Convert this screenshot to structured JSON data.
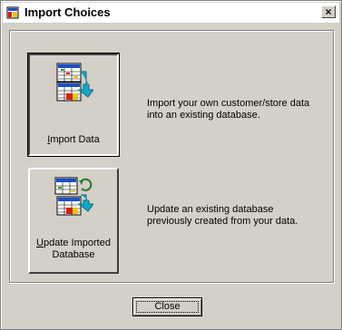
{
  "window": {
    "title": "Import Choices",
    "close_glyph": "×"
  },
  "buttons": {
    "import": {
      "label_prefix": "",
      "label_access": "I",
      "label_rest": "mport Data",
      "icon": "table-import-icon"
    },
    "update": {
      "label_line1_access": "U",
      "label_line1_rest": "pdate Imported",
      "label_line2": "Database",
      "icon": "table-refresh-icon"
    }
  },
  "descriptions": {
    "import_line1": "Import your own customer/store data",
    "import_line2": "into an existing  database.",
    "update_line1": "Update an existing database",
    "update_line2": "previously created from your data."
  },
  "footer": {
    "close_label": "Close"
  }
}
